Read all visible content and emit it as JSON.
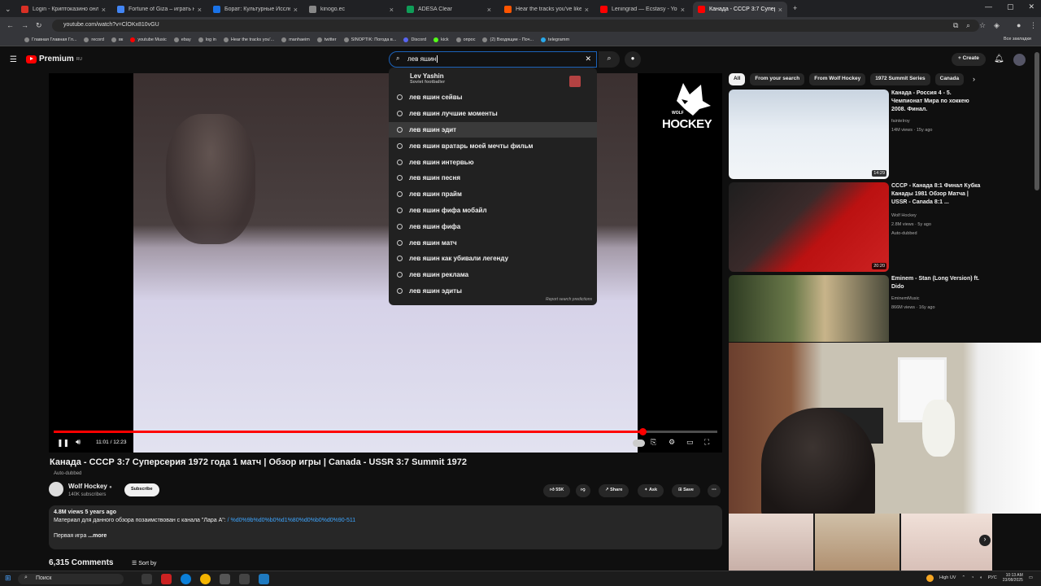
{
  "browser": {
    "tabs": [
      {
        "title": "Login - Криптоказино онлайн",
        "color": "#d93025"
      },
      {
        "title": "Fortune of Giza – играть на оф",
        "color": "#4285f4"
      },
      {
        "title": "Борат: Культурные Исследова",
        "color": "#1a73e8"
      },
      {
        "title": "kinogo.ec",
        "color": "#888888"
      },
      {
        "title": "ADESA Clear",
        "color": "#0f9d58"
      },
      {
        "title": "Hear the tracks you've liked: on",
        "color": "#ff5500"
      },
      {
        "title": "Leningrad — Ecstasy - YouTube",
        "color": "#ff0000"
      },
      {
        "title": "Канада - СССР 3:7 Суперс",
        "color": "#ff0000"
      }
    ],
    "url": "youtube.com/watch?v=ClOKx810vGU",
    "bookmarks": [
      "Главная Главная Гл...",
      "record",
      "вк",
      "youtube Music",
      "ebay",
      "log in",
      "Hear the tracks you'...",
      "manhaeim",
      "twitter",
      "SINOPTIK: Погода в...",
      "Discord",
      "kick",
      "опрос",
      "(2) Входящие - Поч...",
      "telegramm"
    ],
    "all_bookmarks": "Все закладки"
  },
  "yt": {
    "logo_text": "Premium",
    "logo_region": "RU",
    "search_value": "лев яшин",
    "create_label": "Create",
    "suggestions_first": {
      "title": "Lev Yashin",
      "subtitle": "Soviet footballer"
    },
    "suggestions": [
      "лев яшин сейвы",
      "лев яшин лучшие моменты",
      "лев яшин эдит",
      "лев яшин вратарь моей мечты фильм",
      "лев яшин интервью",
      "лев яшин песня",
      "лев яшин прайм",
      "лев яшин фифа мобайл",
      "лев яшин фифа",
      "лев яшин матч",
      "лев яшин как убивали легенду",
      "лев яшин реклама",
      "лев яшин эдиты"
    ],
    "report_label": "Report search predictions"
  },
  "video": {
    "title": "Канада - СССР 3:7 Суперсерия 1972 года 1 матч | Обзор игры | Canada - USSR 3:7 Summit 1972",
    "auto_dubbed": "Auto-dubbed",
    "time": "11:01 / 12:23",
    "progress": 0.887,
    "logo_text": "HOCKEY",
    "logo_wolf": "WOLF",
    "channel": "Wolf Hockey",
    "subscribers": "140K subscribers",
    "subscribe_label": "Subscribe",
    "likes": "55K",
    "share_label": "Share",
    "ask_label": "Ask",
    "save_label": "Save",
    "views_date": "4.8M views  5 years ago",
    "desc_line1": "Материал для данного обзора позаимствован с канала \"Лара А\": ",
    "desc_link": "/ %d0%9b%d0%b0%d1%80%d0%b0%d0%90-511",
    "desc_line2": "Первая игра",
    "more_label": "...more",
    "comments": "6,315 Comments",
    "sort_by": "Sort by"
  },
  "sidebar": {
    "chips": [
      "All",
      "From your search",
      "From Wolf Hockey",
      "1972 Summit Series",
      "Canada"
    ],
    "recs": [
      {
        "title": "Канада - Россия 4 - 5. Чемпионат Мира по хоккею 2008. Финал.",
        "channel": "fainteIroy",
        "meta": "14M views · 15y ago",
        "duration": "14:29"
      },
      {
        "title": "СССР - Канада  8:1 Финал Кубка Канады 1981 Обзор Матча | USSR - Canada 8:1 ...",
        "channel": "Wolf Hockey",
        "meta": "2.8M views · 5y ago",
        "badge": "Auto-dubbed",
        "duration": "20:20"
      },
      {
        "title": "Eminem - Stan (Long Version) ft. Dido",
        "channel": "EminemMusic",
        "meta": "866M views · 16y ago",
        "duration": ""
      }
    ]
  },
  "taskbar": {
    "search_placeholder": "Поиск",
    "weather": "High UV",
    "lang": "РУС",
    "time": "10:13 AM",
    "date": "23/08/2025"
  },
  "colors": {
    "accent": "#ff0000",
    "link": "#3ea6ff",
    "focus": "#1c62b9"
  }
}
